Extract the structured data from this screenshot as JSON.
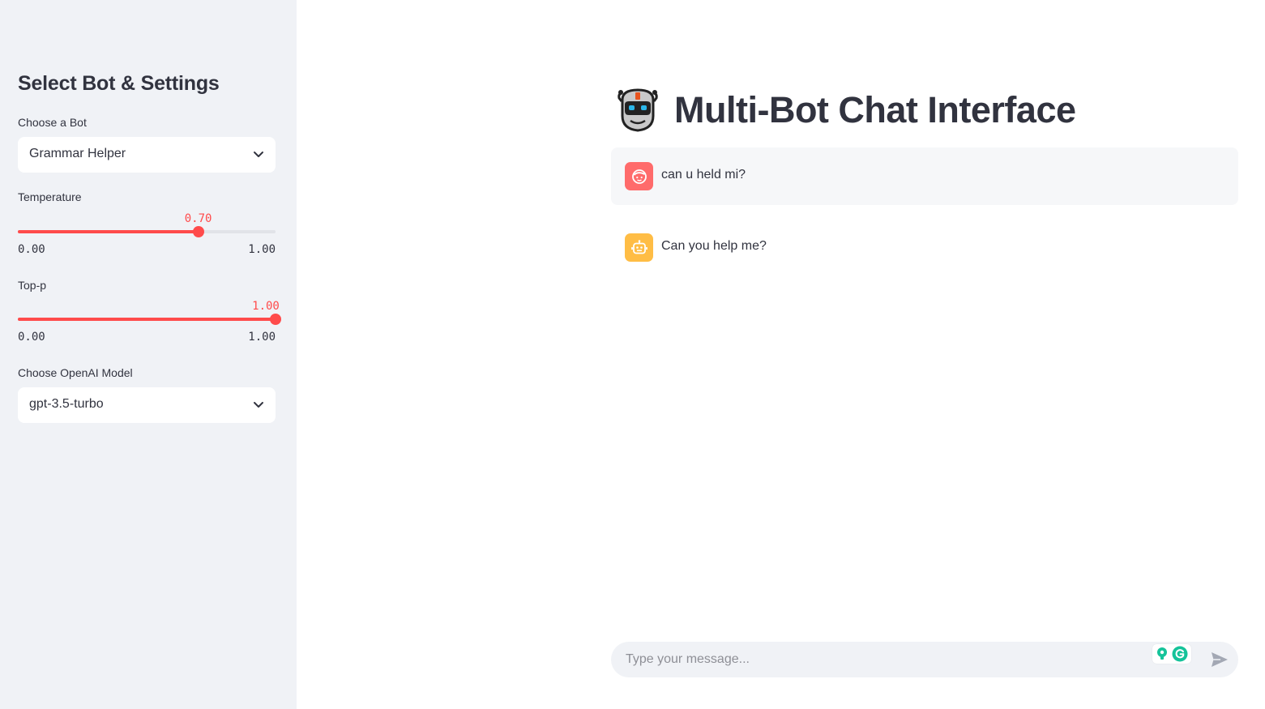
{
  "sidebar": {
    "title": "Select Bot & Settings",
    "bot_select": {
      "label": "Choose a Bot",
      "value": "Grammar Helper"
    },
    "temperature": {
      "label": "Temperature",
      "value": 0.7,
      "value_text": "0.70",
      "min_text": "0.00",
      "max_text": "1.00"
    },
    "top_p": {
      "label": "Top-p",
      "value": 1.0,
      "value_text": "1.00",
      "min_text": "0.00",
      "max_text": "1.00"
    },
    "model_select": {
      "label": "Choose OpenAI Model",
      "value": "gpt-3.5-turbo"
    }
  },
  "main": {
    "title": "Multi-Bot Chat Interface",
    "title_icon": "robot-icon",
    "messages": [
      {
        "role": "user",
        "avatar_icon": "user-face-icon",
        "text": "can u held mi?"
      },
      {
        "role": "assistant",
        "avatar_icon": "bot-icon",
        "text": "Can you help me?"
      }
    ],
    "chat_input": {
      "placeholder": "Type your message..."
    }
  },
  "colors": {
    "accent": "#ff4b4b",
    "sidebar_bg": "#f0f2f6",
    "user_avatar": "#ff6b6b",
    "bot_avatar": "#ffbd45",
    "text": "#31333f",
    "grammarly": "#15c39a"
  },
  "icons": [
    "chevron-down-icon",
    "robot-icon",
    "user-face-icon",
    "bot-icon",
    "grammarly-icon",
    "lightbulb-icon",
    "send-icon"
  ]
}
